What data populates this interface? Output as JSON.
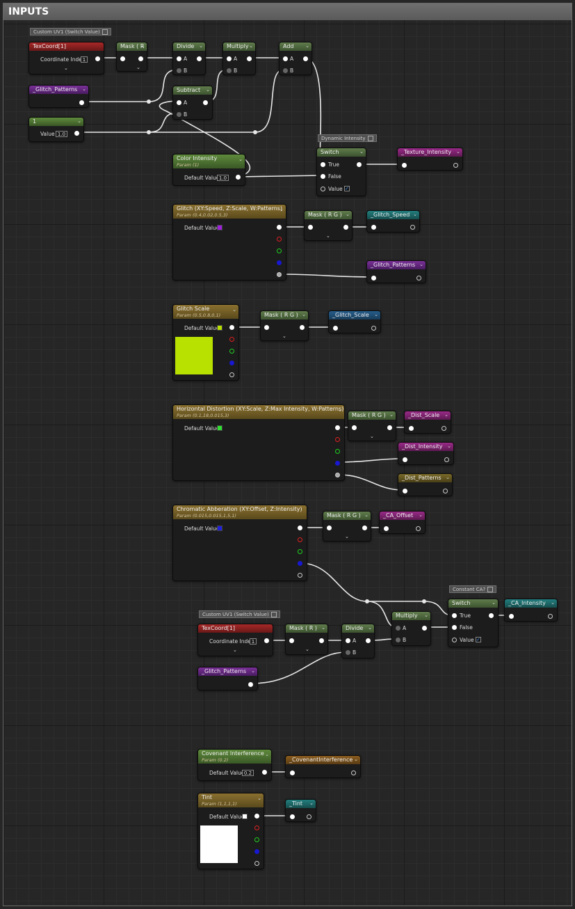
{
  "panel": {
    "title": "INPUTS"
  },
  "chevron": "⌄",
  "comments": {
    "custom_uv1_top": "Custom UV1 (Switch Value)",
    "dynamic_intensity": "Dynamic Intensity",
    "constant_ca": "Constant CA?",
    "custom_uv1_bottom": "Custom UV1 (Switch Value)"
  },
  "pins": {
    "a": "A",
    "b": "B",
    "true": "True",
    "false": "False",
    "value": "Value"
  },
  "nodes": {
    "texcoord_top": {
      "title": "TexCoord[1]",
      "label": "Coordinate Index",
      "value": "1"
    },
    "mask_r_top": {
      "title": "Mask ( R )"
    },
    "divide_top": {
      "title": "Divide"
    },
    "multiply_top": {
      "title": "Multiply"
    },
    "add_top": {
      "title": "Add"
    },
    "glitch_patterns_get1": {
      "title": "_Glitch_Patterns"
    },
    "subtract": {
      "title": "Subtract"
    },
    "const_one": {
      "title": "1",
      "label": "Value",
      "value": "1.0"
    },
    "color_intensity": {
      "title": "Color Intensity",
      "sub": "Param (1)",
      "label": "Default Value",
      "value": "1.0"
    },
    "switch_dynamic": {
      "title": "Switch",
      "checked": "✓"
    },
    "texture_intensity": {
      "title": "_Texture_Intensity"
    },
    "glitch_param": {
      "title": "Glitch (XY:Speed, Z:Scale, W:Patterns)",
      "sub": "Param (0.4,0.02,0.5,3)",
      "label": "Default Value",
      "swatch": "#a020e0"
    },
    "mask_rg_glitch": {
      "title": "Mask ( R G )"
    },
    "glitch_speed": {
      "title": "_Glitch_Speed"
    },
    "glitch_patterns_set": {
      "title": "_Glitch_Patterns"
    },
    "glitch_scale_param": {
      "title": "Glitch Scale",
      "sub": "Param (0.5,0.8,0,1)",
      "label": "Default Value",
      "swatch": "#b8e000"
    },
    "mask_rg_scale": {
      "title": "Mask ( R G )"
    },
    "glitch_scale_set": {
      "title": "_Glitch_Scale"
    },
    "hdist_param": {
      "title": "Horizontal Distortion (XY:Scale, Z:Max Intensity, W:Patterns)",
      "sub": "Param (0.1,18,0.015,3)",
      "label": "Default Value",
      "swatch": "#30e030"
    },
    "mask_rg_dist": {
      "title": "Mask ( R G )"
    },
    "dist_scale": {
      "title": "_Dist_Scale"
    },
    "dist_intensity": {
      "title": "_Dist_Intensity"
    },
    "dist_patterns": {
      "title": "_Dist_Patterns"
    },
    "ca_param": {
      "title": "Chromatic Abberation (XY:Offset, Z:Intensity)",
      "sub": "Param (0.015,0.015,1,5,1)",
      "label": "Default Value",
      "swatch": "#2020e0"
    },
    "mask_rg_ca": {
      "title": "Mask ( R G )"
    },
    "ca_offset": {
      "title": "_CA_Offset"
    },
    "switch_ca": {
      "title": "Switch",
      "checked": "✓"
    },
    "ca_intensity": {
      "title": "_CA_Intensity"
    },
    "texcoord_bottom": {
      "title": "TexCoord[1]",
      "label": "Coordinate Index",
      "value": "1"
    },
    "mask_r_bottom": {
      "title": "Mask ( R )"
    },
    "divide_bottom": {
      "title": "Divide"
    },
    "multiply_bottom": {
      "title": "Multiply"
    },
    "glitch_patterns_get2": {
      "title": "_Glitch_Patterns"
    },
    "covenant_param": {
      "title": "Covenant Interference",
      "sub": "Param (0.2)",
      "label": "Default Value",
      "value": "0.2"
    },
    "covenant_set": {
      "title": "_CovenantInterference"
    },
    "tint_param": {
      "title": "Tint",
      "sub": "Param (1,1,1,1)",
      "label": "Default Value",
      "swatch": "#ffffff"
    },
    "tint_set": {
      "title": "_Tint"
    }
  },
  "colors": {
    "red": "#8a1c1c",
    "green": "#4d6b3c",
    "purple": "#5a2475",
    "olive": "#6a6a2a",
    "gold": "#7a6424",
    "magenta": "#7d1d6e",
    "teal": "#1d6a6a",
    "blue": "#22507a",
    "brown": "#6a4a1a"
  }
}
